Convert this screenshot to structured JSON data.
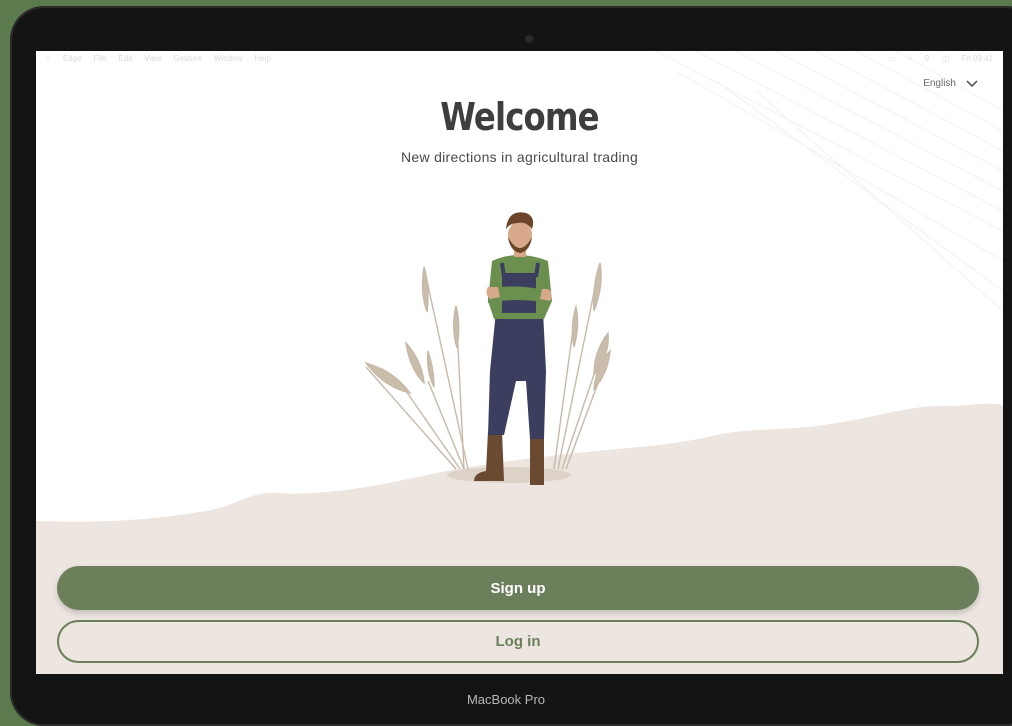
{
  "device": {
    "label": "MacBook Pro"
  },
  "menubar": {
    "items": [
      "Edge",
      "File",
      "Edit",
      "View",
      "Gesture",
      "Window",
      "Help"
    ],
    "clock": "Fri 09:41"
  },
  "language": {
    "selected": "English",
    "icon": "chevron-down-icon"
  },
  "hero": {
    "title": "Welcome",
    "subtitle": "New directions in agricultural trading",
    "illustration": "farmer-in-wheat-field"
  },
  "actions": {
    "signup_label": "Sign up",
    "login_label": "Log in"
  },
  "colors": {
    "accent": "#6b7f5a",
    "ground": "#ece5e0",
    "title": "#3e3e3e",
    "overalls": "#3b3e5e",
    "shirt": "#6b8f4e"
  }
}
